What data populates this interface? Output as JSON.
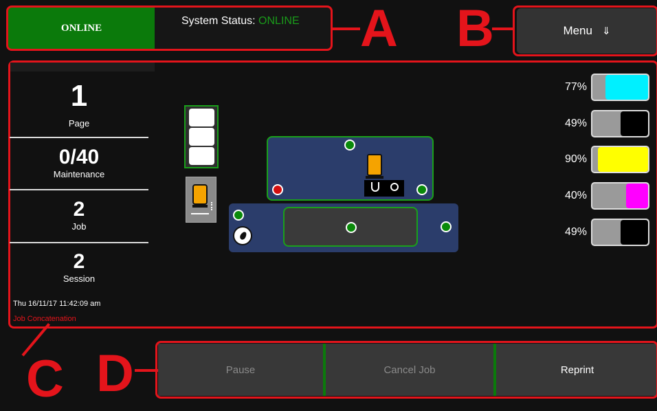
{
  "header": {
    "online_label": "ONLINE",
    "status_label": "System Status:",
    "status_value": "ONLINE",
    "menu_label": "Menu",
    "menu_icon": "⇓"
  },
  "annotations": {
    "a": "A",
    "b": "B",
    "c": "C",
    "d": "D"
  },
  "sidebar": {
    "page": {
      "value": "1",
      "label": "Page"
    },
    "maintenance": {
      "value": "0/40",
      "label": "Maintenance"
    },
    "job": {
      "value": "2",
      "label": "Job"
    },
    "session": {
      "value": "2",
      "label": "Session"
    },
    "datetime": "Thu 16/11/17 11:42:09 am",
    "mode": "Job Concatenation"
  },
  "inks": [
    {
      "pct": "77%",
      "level": 0.77,
      "color": "#00f0ff"
    },
    {
      "pct": "49%",
      "level": 0.49,
      "color": "#000000"
    },
    {
      "pct": "90%",
      "level": 0.9,
      "color": "#ffff00"
    },
    {
      "pct": "40%",
      "level": 0.4,
      "color": "#ff00ff"
    },
    {
      "pct": "49%",
      "level": 0.49,
      "color": "#000000"
    }
  ],
  "actions": {
    "pause": "Pause",
    "cancel": "Cancel Job",
    "reprint": "Reprint"
  },
  "colors": {
    "online_green": "#0b7a0b",
    "annotation_red": "#e4141b",
    "panel_blue": "#2b3d6b",
    "orange": "#f5a300"
  }
}
